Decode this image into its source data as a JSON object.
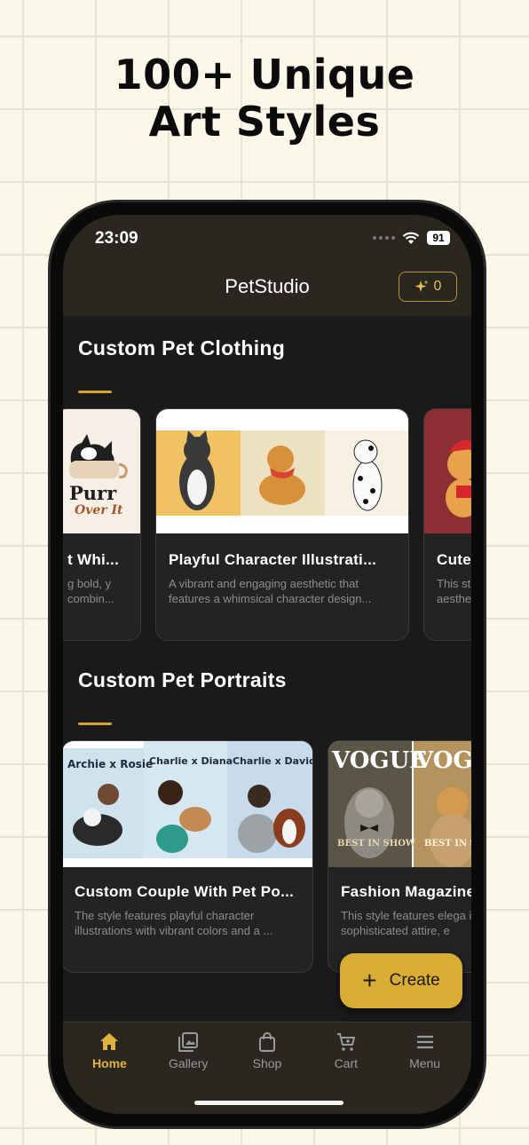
{
  "headline": {
    "line1": "100+ Unique",
    "line2": "Art Styles"
  },
  "status": {
    "time": "23:09",
    "battery": "91"
  },
  "app": {
    "title": "PetStudio",
    "credits": "0"
  },
  "sections": [
    {
      "title": "Custom Pet Clothing",
      "cards": [
        {
          "title": "t Whi...",
          "desc": "g bold, y combin...",
          "thumb_text": [
            "Purr",
            "Over It"
          ]
        },
        {
          "title": "Playful Character Illustrati...",
          "desc": "A vibrant and engaging aesthetic that features a whimsical character design..."
        },
        {
          "title": "Cute",
          "desc": "This st aesthet"
        }
      ]
    },
    {
      "title": "Custom Pet Portraits",
      "cards": [
        {
          "title": "Custom Couple With Pet Po...",
          "desc": "The style features playful character illustrations with vibrant colors and a ...",
          "thumb_text": [
            "Archie x Rosie",
            "Charlie x Diana",
            "Charlie x David"
          ]
        },
        {
          "title": "Fashion Magazine",
          "desc": "This style features elega in sophisticated attire, e",
          "thumb_text": [
            "VOGUE",
            "BEST IN SHOW",
            "VOGU",
            "BEST IN SHOW"
          ]
        }
      ]
    }
  ],
  "fab": {
    "label": "Create"
  },
  "tabs": [
    {
      "label": "Home",
      "icon": "home-icon"
    },
    {
      "label": "Gallery",
      "icon": "gallery-icon"
    },
    {
      "label": "Shop",
      "icon": "shopping-bag-icon"
    },
    {
      "label": "Cart",
      "icon": "cart-icon"
    },
    {
      "label": "Menu",
      "icon": "menu-icon"
    }
  ],
  "colors": {
    "accent": "#d9ad34",
    "background": "#1a1a1a",
    "topbar": "#2a2620"
  }
}
